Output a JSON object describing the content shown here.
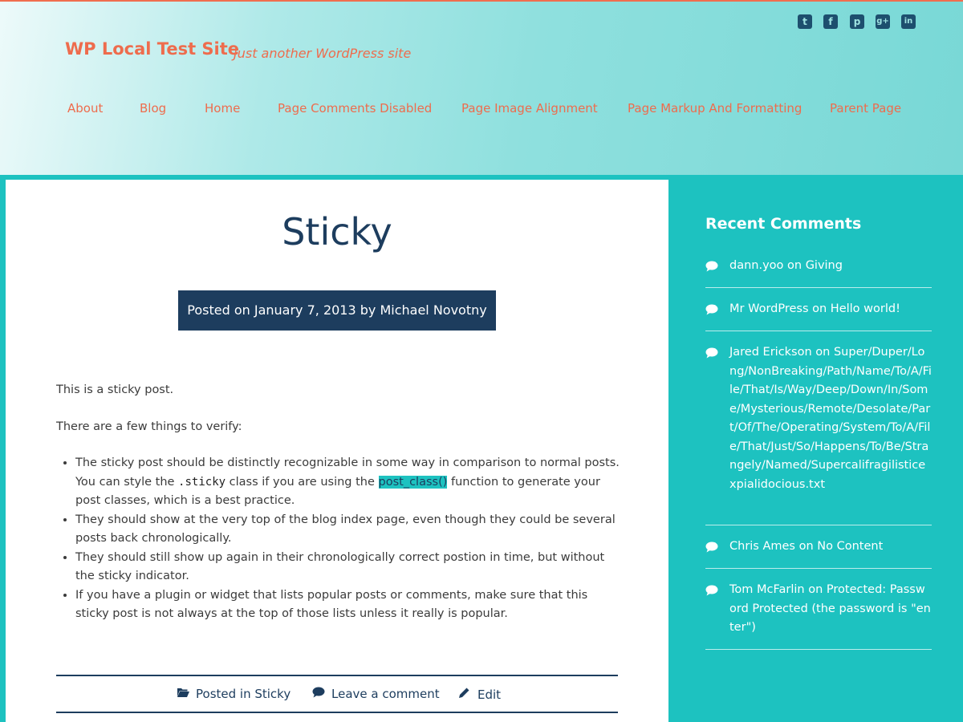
{
  "site": {
    "title": "WP Local Test Site",
    "tagline": "Just another WordPress site"
  },
  "social_icons": [
    "twitter-icon",
    "facebook-icon",
    "pinterest-icon",
    "google-plus-icon",
    "linkedin-icon"
  ],
  "nav": {
    "items": [
      "About",
      "Blog",
      "Home",
      "Page Comments Disabled",
      "Page Image Alignment",
      "Page Markup And Formatting",
      "Parent Page"
    ]
  },
  "post": {
    "title": "Sticky",
    "meta": {
      "prefix": "Posted on ",
      "date": "January 7, 2013",
      "by": " by ",
      "author": "Michael Novotny"
    },
    "para1": "This is a sticky post.",
    "para2": "There are a few things to verify:",
    "bullet1": {
      "before": "The sticky post should be distinctly recognizable in some way in comparison to normal posts. You can style the ",
      "code": ".sticky",
      "middle": " class if you are using the ",
      "highlight": "post_class()",
      "after": " function to generate your post classes, which is a best practice."
    },
    "bullet2": "They should show at the very top of the blog index page, even though they could be several posts back chronologically.",
    "bullet3": "They should still show up again in their chronologically correct postion in time, but without the sticky indicator.",
    "bullet4": "If you have a plugin or widget that lists popular posts or comments, make sure that this sticky post is not always at the top of those lists unless it really is popular.",
    "footer": {
      "posted_in": "Posted in ",
      "category": "Sticky",
      "comment": "Leave a comment",
      "edit": "Edit"
    }
  },
  "sidebar": {
    "title": "Recent Comments",
    "comments": [
      {
        "author": "dann.yoo",
        "on": " on ",
        "post": "Giving"
      },
      {
        "author": "Mr WordPress",
        "on": " on ",
        "post": "Hello world!"
      },
      {
        "author": "Jared Erickson",
        "on": " on ",
        "post": "Super/Duper/Long/NonBreaking/Path/Name/To/A/File/That/Is/Way/Deep/Down/In/Some/Mysterious/Remote/Desolate/Part/Of/The/Operating/System/To/A/File/That/Just/So/Happens/To/Be/Strangely/Named/Supercalifragilisticexpialidocious.txt"
      },
      {
        "author": "Chris Ames",
        "on": " on ",
        "post": "No Content"
      },
      {
        "author": "Tom McFarlin",
        "on": " on ",
        "post": "Protected: Password Protected (the password is \"enter\")"
      }
    ]
  },
  "colors": {
    "accent": "#ee6c4d",
    "navy": "#1d3d5e",
    "teal": "#1dc2c0"
  }
}
